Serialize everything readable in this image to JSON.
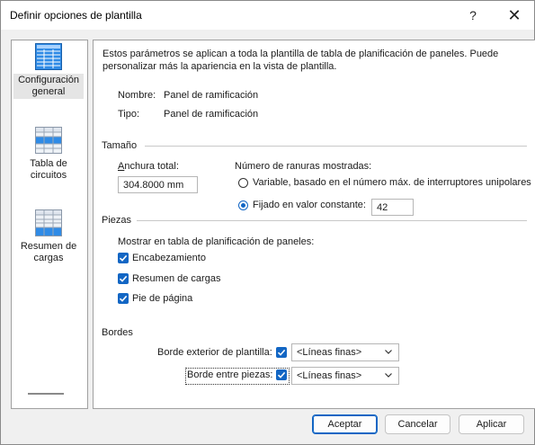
{
  "window": {
    "title": "Definir opciones de plantilla",
    "help": "?",
    "close": "✕"
  },
  "sidebar": {
    "items": [
      {
        "label": "Configuración general",
        "icon": "grid-table-icon"
      },
      {
        "label": "Tabla de circuitos",
        "icon": "circuit-table-icon"
      },
      {
        "label": "Resumen de cargas",
        "icon": "load-summary-icon"
      }
    ]
  },
  "main": {
    "description": "Estos parámetros se aplican a toda la plantilla de tabla de planificación de paneles. Puede personalizar más la apariencia en la vista de plantilla.",
    "name_label": "Nombre:",
    "name_value": "Panel de ramificación",
    "type_label": "Tipo:",
    "type_value": "Panel de ramificación",
    "size": {
      "title": "Tamaño",
      "width_label": "Anchura total:",
      "width_value": "304.8000 mm",
      "slots_label": "Número de ranuras mostradas:",
      "radio_variable": "Variable, basado en el número máx. de interruptores unipolares",
      "radio_fixed": "Fijado en valor constante:",
      "fixed_value": "42"
    },
    "parts": {
      "title": "Piezas",
      "show_label": "Mostrar en tabla de planificación de paneles:",
      "header": "Encabezamiento",
      "loads": "Resumen de cargas",
      "footer": "Pie de página"
    },
    "borders": {
      "title": "Bordes",
      "outer_label": "Borde exterior de plantilla:",
      "outer_value": "<Líneas finas>",
      "between_label": "Borde entre piezas:",
      "between_value": "<Líneas finas>"
    }
  },
  "buttons": {
    "ok": "Aceptar",
    "cancel": "Cancelar",
    "apply": "Aplicar"
  },
  "colors": {
    "accent": "#1266c4",
    "icon_blue": "#2f8be6"
  }
}
